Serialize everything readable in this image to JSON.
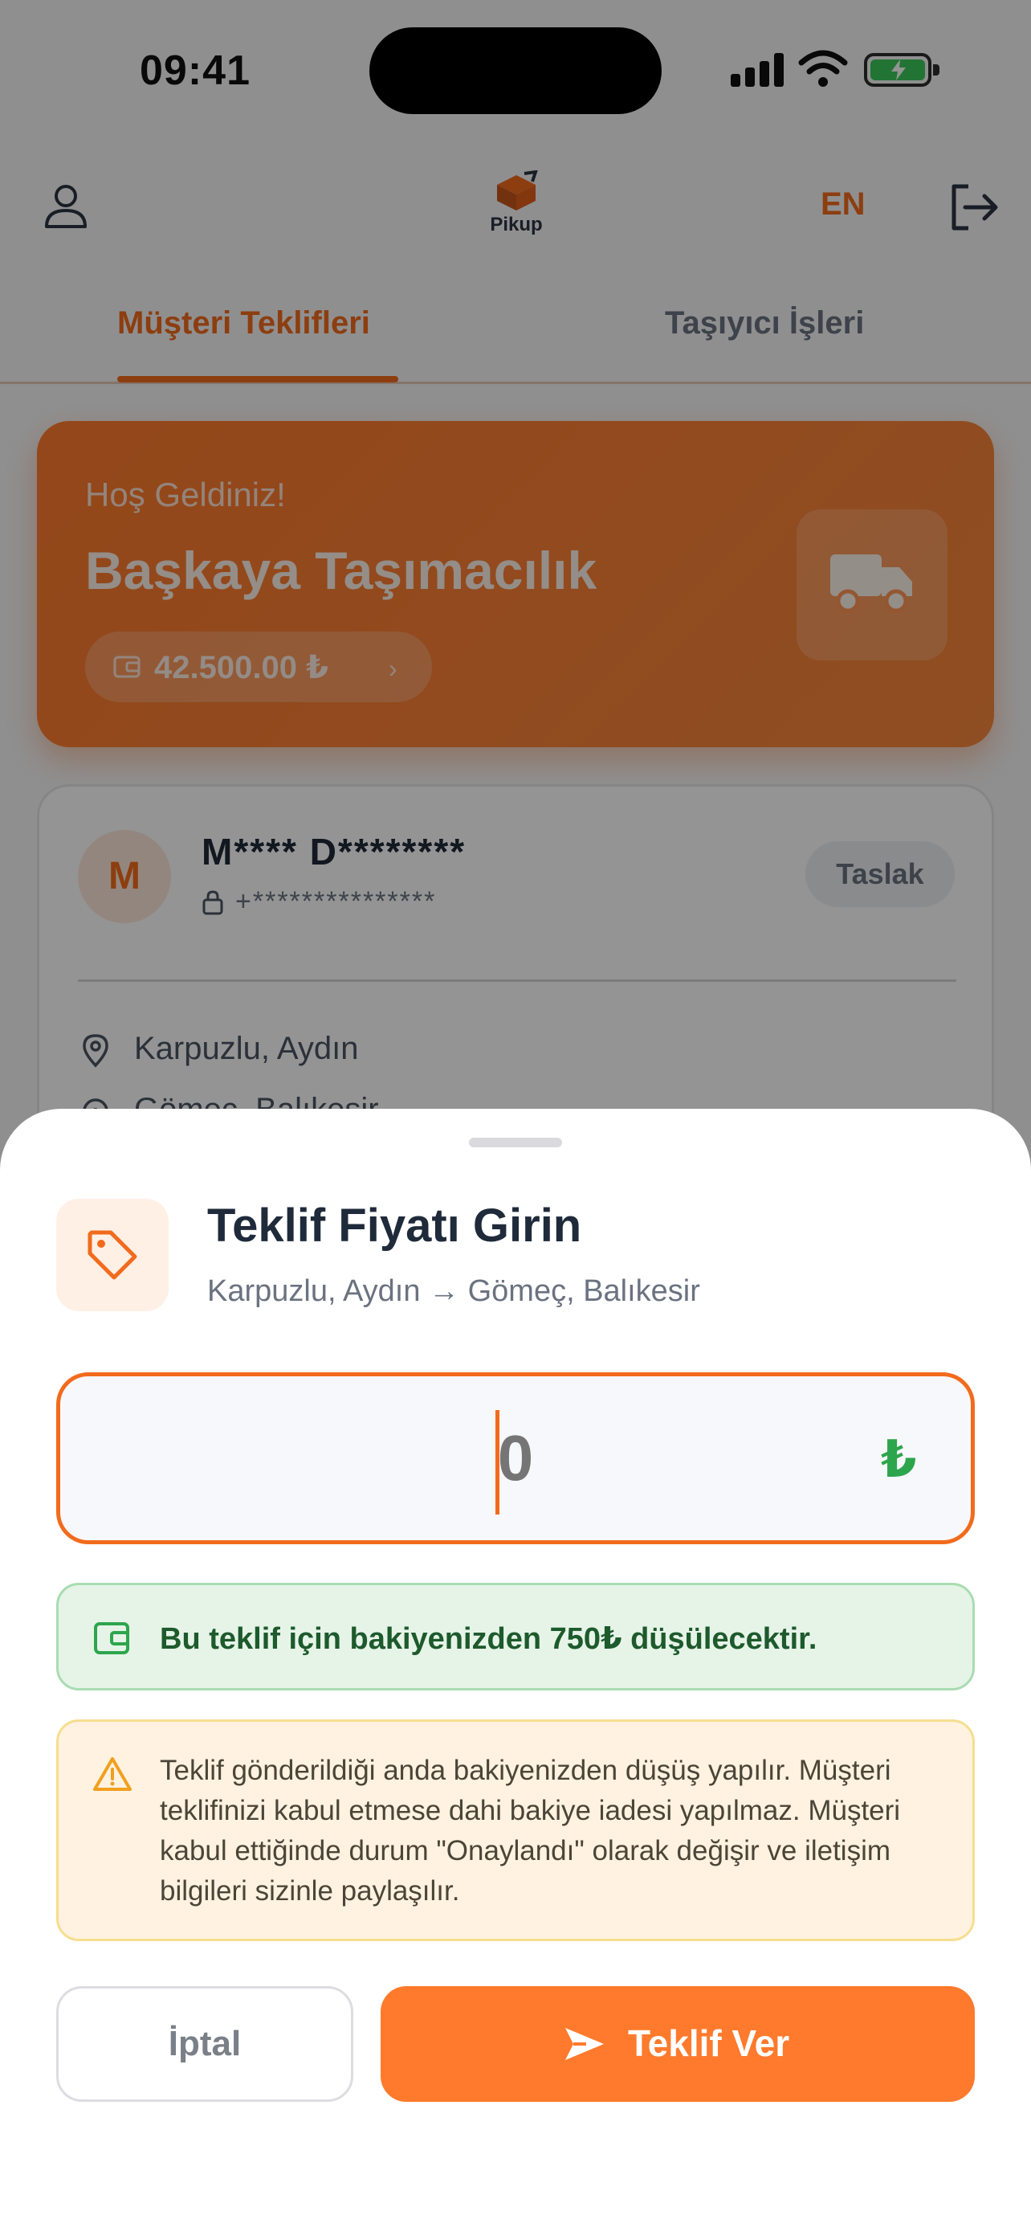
{
  "status_bar": {
    "time": "09:41"
  },
  "header": {
    "app_name": "Pikup",
    "language": "EN"
  },
  "tabs": [
    {
      "label": "Müşteri Teklifleri",
      "active": true
    },
    {
      "label": "Taşıyıcı İşleri",
      "active": false
    }
  ],
  "welcome": {
    "greeting": "Hoş Geldiniz!",
    "company": "Başkaya Taşımacılık",
    "balance": "42.500.00 ₺"
  },
  "customer_card": {
    "avatar_initial": "M",
    "name": "M**** D********",
    "phone": "+***************",
    "status": "Taslak",
    "from": "Karpuzlu, Aydın",
    "to": "Gömeç, Balıkesir"
  },
  "sheet": {
    "title": "Teklif Fiyatı Girin",
    "route": "Karpuzlu, Aydın → Gömeç, Balıkesir",
    "price_placeholder": "0",
    "currency_symbol": "₺",
    "deduction_info": "Bu teklif için bakiyenizden 750₺ düşülecektir.",
    "warning": "Teklif gönderildiği anda bakiyenizden düşüş yapılır. Müşteri teklifinizi kabul etmese dahi bakiye iadesi yapılmaz. Müşteri kabul ettiğinde durum \"Onaylandı\" olarak değişir ve iletişim bilgileri sizinle paylaşılır.",
    "cancel_label": "İptal",
    "submit_label": "Teklif Ver"
  },
  "colors": {
    "accent": "#ff7a2c",
    "success": "#2da54d",
    "warning": "#f0a020"
  }
}
